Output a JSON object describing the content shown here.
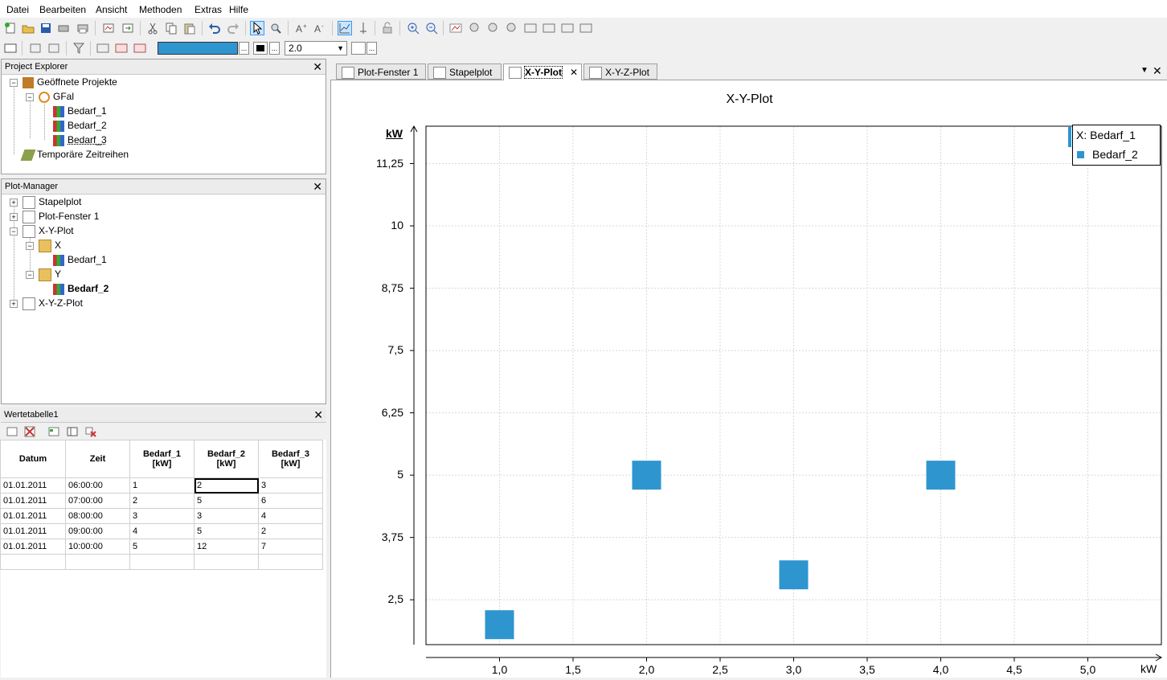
{
  "menu": [
    "Datei",
    "Bearbeiten",
    "Ansicht",
    "Methoden",
    "Extras",
    "Hilfe"
  ],
  "toolbar2": {
    "line_width": "2.0"
  },
  "project_explorer": {
    "title": "Project Explorer",
    "items": [
      "Geöffnete Projekte",
      "GFal",
      "Bedarf_1",
      "Bedarf_2",
      "Bedarf_3",
      "Temporäre Zeitreihen"
    ]
  },
  "plot_manager": {
    "title": "Plot-Manager",
    "items": [
      "Stapelplot",
      "Plot-Fenster 1",
      "X-Y-Plot",
      "X",
      "Bedarf_1",
      "Y",
      "Bedarf_2",
      "X-Y-Z-Plot"
    ]
  },
  "value_table": {
    "title": "Wertetabelle1",
    "headers": [
      "Datum",
      "Zeit",
      "Bedarf_1\n[kW]",
      "Bedarf_2\n[kW]",
      "Bedarf_3\n[kW]"
    ],
    "rows": [
      [
        "01.01.2011",
        "06:00:00",
        "1",
        "2",
        "3"
      ],
      [
        "01.01.2011",
        "07:00:00",
        "2",
        "5",
        "6"
      ],
      [
        "01.01.2011",
        "08:00:00",
        "3",
        "3",
        "4"
      ],
      [
        "01.01.2011",
        "09:00:00",
        "4",
        "5",
        "2"
      ],
      [
        "01.01.2011",
        "10:00:00",
        "5",
        "12",
        "7"
      ]
    ]
  },
  "tabs": [
    "Plot-Fenster 1",
    "Stapelplot",
    "X-Y-Plot",
    "X-Y-Z-Plot"
  ],
  "active_tab": "X-Y-Plot",
  "colors": {
    "series": "#2e95cf",
    "selection": "#3399ff"
  },
  "chart_data": {
    "type": "scatter",
    "title": "X-Y-Plot",
    "xlabel": "kW",
    "ylabel": "kW",
    "xlim": [
      0.5,
      5.5
    ],
    "ylim": [
      1.6,
      12.0
    ],
    "xticks": [
      "1,0",
      "1,5",
      "2,0",
      "2,5",
      "3,0",
      "3,5",
      "4,0",
      "4,5",
      "5,0"
    ],
    "yticks": [
      "2,5",
      "3,75",
      "5",
      "6,25",
      "7,5",
      "8,75",
      "10",
      "11,25"
    ],
    "legend": [
      "X:  Bedarf_1",
      "Bedarf_2"
    ],
    "grid": true,
    "points": [
      {
        "x": 1,
        "y": 2
      },
      {
        "x": 2,
        "y": 5
      },
      {
        "x": 3,
        "y": 3
      },
      {
        "x": 4,
        "y": 5
      },
      {
        "x": 5,
        "y": 12
      }
    ]
  }
}
